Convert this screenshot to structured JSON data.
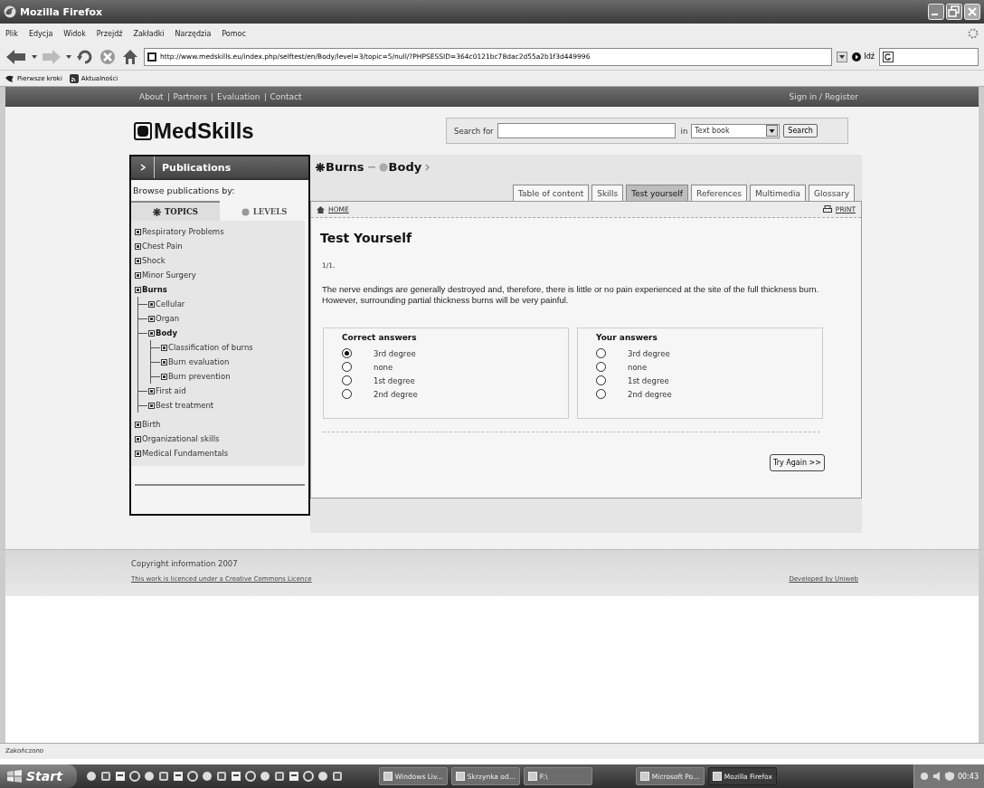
{
  "window": {
    "title": "Mozilla Firefox"
  },
  "menu": [
    "Plik",
    "Edycja",
    "Widok",
    "Przejdź",
    "Zakładki",
    "Narzędzia",
    "Pomoc"
  ],
  "address_bar": {
    "url": "http://www.medskills.eu/index.php/selftest/en/Body/level=3/topic=5/null/?PHPSESSID=364c0121bc78dac2d55a2b1f3d449996",
    "go_label": "Idź"
  },
  "bookmarks": [
    "Pierwsze kroki",
    "Aktualności"
  ],
  "site_nav": {
    "links": [
      "About",
      "Partners",
      "Evaluation",
      "Contact"
    ],
    "sign_in": "Sign in / Register"
  },
  "logo": "MedSkills",
  "search": {
    "label": "Search for",
    "in_label": "in",
    "scope": "Text book",
    "button": "Search"
  },
  "sidebar": {
    "title": "Publications",
    "subtitle": "Browse publications by:",
    "tabs": [
      {
        "label": "TOPICS",
        "selected": true
      },
      {
        "label": "LEVELS",
        "selected": false
      }
    ],
    "tree": [
      {
        "label": "Respiratory Problems",
        "current": false
      },
      {
        "label": "Chest Pain",
        "current": false
      },
      {
        "label": "Shock",
        "current": false
      },
      {
        "label": "Minor Surgery",
        "current": false
      },
      {
        "label": "Burns",
        "current": true,
        "children": [
          {
            "label": "Cellular",
            "current": false
          },
          {
            "label": "Organ",
            "current": false
          },
          {
            "label": "Body",
            "current": true,
            "children": [
              {
                "label": "Classification of burns",
                "current": false
              },
              {
                "label": "Burn evaluation",
                "current": false
              },
              {
                "label": "Burn prevention",
                "current": false
              }
            ]
          },
          {
            "label": "First aid",
            "current": false
          },
          {
            "label": "Best treatment",
            "current": false
          }
        ]
      },
      {
        "label": "Birth",
        "current": false
      },
      {
        "label": "Organizational skills",
        "current": false
      },
      {
        "label": "Medical Fundamentals",
        "current": false
      }
    ]
  },
  "breadcrumb": [
    "Burns",
    "Body"
  ],
  "tabs": [
    {
      "label": "Table of content",
      "selected": false
    },
    {
      "label": "Skills",
      "selected": false
    },
    {
      "label": "Test yourself",
      "selected": true
    },
    {
      "label": "References",
      "selected": false
    },
    {
      "label": "Multimedia",
      "selected": false
    },
    {
      "label": "Glossary",
      "selected": false
    }
  ],
  "toolbar": {
    "home": "HOME",
    "print": "PRINT"
  },
  "test": {
    "heading": "Test Yourself",
    "number": "1/1.",
    "text": "The nerve endings are generally destroyed and, therefore, there is little or no pain experienced at the site of the full thickness burn. However, surrounding partial thickness burns will be very painful.",
    "answer_groups": [
      {
        "title": "Correct answers",
        "options": [
          {
            "label": "3rd degree",
            "selected": true
          },
          {
            "label": "none",
            "selected": false
          },
          {
            "label": "1st degree",
            "selected": false
          },
          {
            "label": "2nd degree",
            "selected": false
          }
        ]
      },
      {
        "title": "Your answers",
        "options": [
          {
            "label": "3rd degree",
            "selected": false
          },
          {
            "label": "none",
            "selected": false
          },
          {
            "label": "1st degree",
            "selected": false
          },
          {
            "label": "2nd degree",
            "selected": false
          }
        ]
      }
    ],
    "button": "Try Again >>"
  },
  "footer": {
    "copyright": "Copyright information 2007",
    "licence": "This work is licenced under a Creative Commons Licence",
    "developer": "Developed by Uniweb"
  },
  "status_bar": "Zakończono",
  "taskbar": {
    "start": "Start",
    "tasks": [
      {
        "label": "Windows Liv...",
        "selected": false
      },
      {
        "label": "Skrzynka od...",
        "selected": false
      },
      {
        "label": "F:\\",
        "selected": false
      },
      {
        "label": "Microsoft Po...",
        "selected": false
      },
      {
        "label": "Mozilla Firefox",
        "selected": true
      }
    ],
    "clock": "00:43"
  }
}
